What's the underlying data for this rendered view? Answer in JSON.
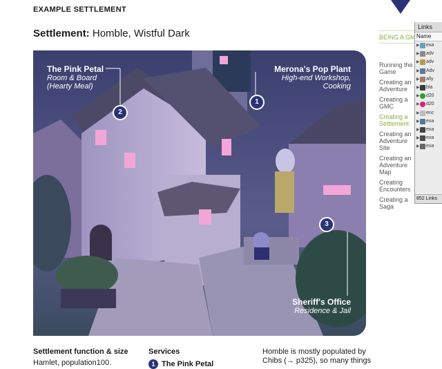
{
  "page": {
    "section_label": "EXAMPLE SETTLEMENT",
    "heading_bold": "Settlement:",
    "heading_rest": "Homble, Wistful Dark"
  },
  "callouts": [
    {
      "title": "The Pink Petal",
      "line1": "Room & Board",
      "line2": "(Hearty Meal)"
    },
    {
      "title": "Merona's Pop Plant",
      "line1": "High-end Workshop,",
      "line2": "Cooking"
    },
    {
      "title": "Sheriff's Office",
      "line1": "Residence & Jail"
    }
  ],
  "badges": [
    "2",
    "1",
    "3"
  ],
  "bottom": {
    "function_head": "Settlement function & size",
    "function_text": "Hamlet, population100.",
    "services_head": "Services",
    "service_1_num": "1",
    "service_1_name": "The Pink Petal",
    "para_line1": "Homble is mostly populated by",
    "para_line2": "Chibs (→ p325), so many things"
  },
  "sidebar": {
    "active_head": "BEING A GM",
    "items": [
      {
        "label": "Running the Game",
        "active": false
      },
      {
        "label": "Creating an Adventure",
        "active": false
      },
      {
        "label": "Creating a GMC",
        "active": false
      },
      {
        "label": "Creating a Settlement",
        "active": true
      },
      {
        "label": "Creating an Adventure Site",
        "active": false
      },
      {
        "label": "Creating an Adventure Map",
        "active": false
      },
      {
        "label": "Creating Encounters",
        "active": false
      },
      {
        "label": "Creating a Saga",
        "active": false
      }
    ]
  },
  "links_panel": {
    "title": "Links",
    "column": "Name",
    "rows": [
      {
        "label": "exa",
        "icon": "image-icon",
        "color": "#6aa0b8"
      },
      {
        "label": "adv",
        "icon": "image-icon",
        "color": "#8c8c8c"
      },
      {
        "label": "adv",
        "icon": "image-icon",
        "color": "#b79a50"
      },
      {
        "label": "Adv",
        "icon": "image-icon",
        "color": "#5a7a9a"
      },
      {
        "label": "ally",
        "icon": "image-icon",
        "color": "#a08070"
      },
      {
        "label": "bla",
        "icon": "image-icon",
        "color": "#3a3a3a"
      },
      {
        "label": "d20",
        "icon": "dot-icon",
        "color": "#2aa02a"
      },
      {
        "label": "d20",
        "icon": "dot-icon",
        "color": "#e0207a"
      },
      {
        "label": "enc",
        "icon": "image-icon",
        "color": "#bbbbbb"
      },
      {
        "label": "exa",
        "icon": "image-icon",
        "color": "#557799"
      },
      {
        "label": "exa",
        "icon": "image-icon",
        "color": "#444444"
      },
      {
        "label": "exa",
        "icon": "image-icon",
        "color": "#4a4a4a"
      },
      {
        "label": "exa",
        "icon": "image-icon",
        "color": "#666666"
      }
    ],
    "footer": "852 Links"
  },
  "colors": {
    "badge_navy": "#2b3377",
    "active_nav_green": "#7fb33a"
  }
}
